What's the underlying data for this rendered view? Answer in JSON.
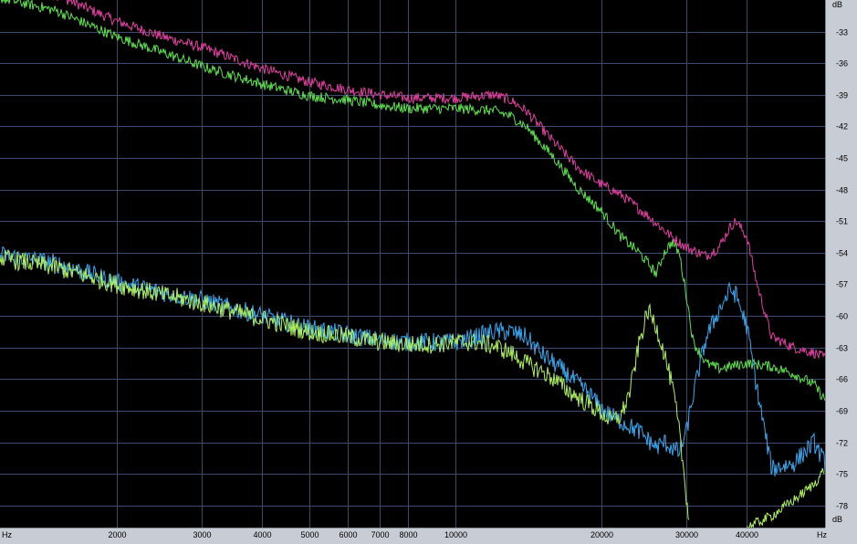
{
  "chart_data": {
    "type": "line",
    "title": "",
    "xlabel": "Hz",
    "ylabel": "dB",
    "x_scale": "log",
    "xlim": [
      1150,
      58000
    ],
    "ylim": [
      -80.1,
      -30
    ],
    "x_ticks": [
      2000,
      3000,
      4000,
      5000,
      6000,
      7000,
      8000,
      10000,
      20000,
      30000,
      40000
    ],
    "y_ticks": [
      -33,
      -36,
      -39,
      -42,
      -45,
      -48,
      -51,
      -54,
      -57,
      -60,
      -63,
      -66,
      -69,
      -72,
      -75,
      -78
    ],
    "grid": true,
    "legend": "none",
    "colors": {
      "background": "#000000",
      "grid": "#3a4a6a",
      "axis_panel": "#c8ccd4",
      "series_pink": "#e040a0",
      "series_green": "#60e050",
      "series_blue": "#3aa8f0",
      "series_lightgreen": "#b0f060"
    },
    "series": [
      {
        "color": "series_pink",
        "noise": 0.5,
        "x": [
          1150,
          1500,
          2000,
          2500,
          3000,
          4000,
          5000,
          6000,
          7000,
          8000,
          10000,
          12000,
          13000,
          14000,
          16000,
          18000,
          20000,
          22000,
          25000,
          28000,
          30000,
          33000,
          35000,
          37000,
          38000,
          40000,
          42000,
          45000,
          50000,
          55000,
          58000
        ],
        "y": [
          -28.5,
          -29.5,
          -32.0,
          -33.5,
          -34.5,
          -36.5,
          -37.8,
          -38.5,
          -39.0,
          -39.3,
          -39.3,
          -39.0,
          -39.5,
          -40.5,
          -43.5,
          -46.0,
          -47.5,
          -48.5,
          -50.5,
          -52.5,
          -53.5,
          -54.3,
          -53.5,
          -51.5,
          -51.0,
          -52.5,
          -57.0,
          -62.0,
          -63.0,
          -63.5,
          -64.0
        ]
      },
      {
        "color": "series_green",
        "noise": 0.5,
        "x": [
          1150,
          1500,
          2000,
          2500,
          3000,
          4000,
          5000,
          6000,
          7000,
          8000,
          10000,
          12000,
          13000,
          14000,
          16000,
          18000,
          20000,
          22000,
          24000,
          25000,
          26000,
          27000,
          28000,
          29000,
          30000,
          31000,
          33000,
          35000,
          37000,
          40000,
          45000,
          50000,
          55000,
          58000
        ],
        "y": [
          -29.8,
          -31.0,
          -33.5,
          -35.0,
          -36.3,
          -38.0,
          -39.1,
          -39.5,
          -40.0,
          -40.3,
          -40.3,
          -40.5,
          -41.0,
          -42.0,
          -45.0,
          -48.0,
          -50.0,
          -52.5,
          -54.0,
          -55.0,
          -56.0,
          -54.0,
          -53.0,
          -54.0,
          -58.0,
          -62.5,
          -64.5,
          -65.0,
          -64.8,
          -64.5,
          -64.8,
          -65.5,
          -66.5,
          -68.0
        ]
      },
      {
        "color": "series_blue",
        "noise": 0.9,
        "x": [
          1150,
          1500,
          2000,
          2500,
          3000,
          4000,
          5000,
          6000,
          7000,
          8000,
          9000,
          10000,
          11000,
          12000,
          13000,
          14000,
          15000,
          16000,
          17000,
          18000,
          19000,
          20000,
          21000,
          22000,
          24000,
          26000,
          27000,
          28000,
          29000,
          30000,
          31000,
          33000,
          35000,
          37000,
          38000,
          40000,
          42000,
          45000,
          50000,
          55000,
          58000
        ],
        "y": [
          -54.2,
          -55.0,
          -56.8,
          -57.8,
          -58.5,
          -60.0,
          -61.2,
          -61.8,
          -62.3,
          -62.5,
          -62.5,
          -62.5,
          -62.0,
          -61.5,
          -61.5,
          -62.0,
          -63.5,
          -64.5,
          -65.5,
          -66.5,
          -67.5,
          -68.8,
          -69.5,
          -70.0,
          -71.0,
          -72.5,
          -72.0,
          -72.5,
          -73.0,
          -71.0,
          -67.5,
          -62.0,
          -59.5,
          -57.5,
          -58.0,
          -61.0,
          -67.0,
          -74.5,
          -74.0,
          -72.0,
          -74.0
        ]
      },
      {
        "color": "series_lightgreen",
        "noise": 0.9,
        "x": [
          1150,
          1500,
          2000,
          2500,
          3000,
          4000,
          5000,
          6000,
          7000,
          8000,
          9000,
          10000,
          11000,
          12000,
          13000,
          14000,
          15000,
          16000,
          17000,
          18000,
          19000,
          20000,
          21000,
          22000,
          23000,
          24000,
          25000,
          26000,
          27000,
          28000,
          28500,
          29000,
          29500,
          30000,
          30500
        ],
        "y": [
          -54.5,
          -55.4,
          -57.0,
          -58.0,
          -58.8,
          -60.3,
          -61.5,
          -62.0,
          -62.5,
          -62.7,
          -62.7,
          -62.5,
          -62.5,
          -62.8,
          -63.5,
          -64.5,
          -65.2,
          -66.0,
          -67.0,
          -67.8,
          -68.5,
          -69.2,
          -70.0,
          -69.5,
          -67.0,
          -62.5,
          -59.5,
          -61.0,
          -63.5,
          -66.5,
          -68.5,
          -71.0,
          -74.0,
          -77.0,
          -80.1
        ]
      },
      {
        "color": "series_lightgreen",
        "noise": 0.5,
        "x": [
          40000,
          45000,
          50000,
          55000,
          58000
        ],
        "y": [
          -80.1,
          -79.0,
          -77.5,
          -76.0,
          -74.5
        ]
      }
    ]
  }
}
